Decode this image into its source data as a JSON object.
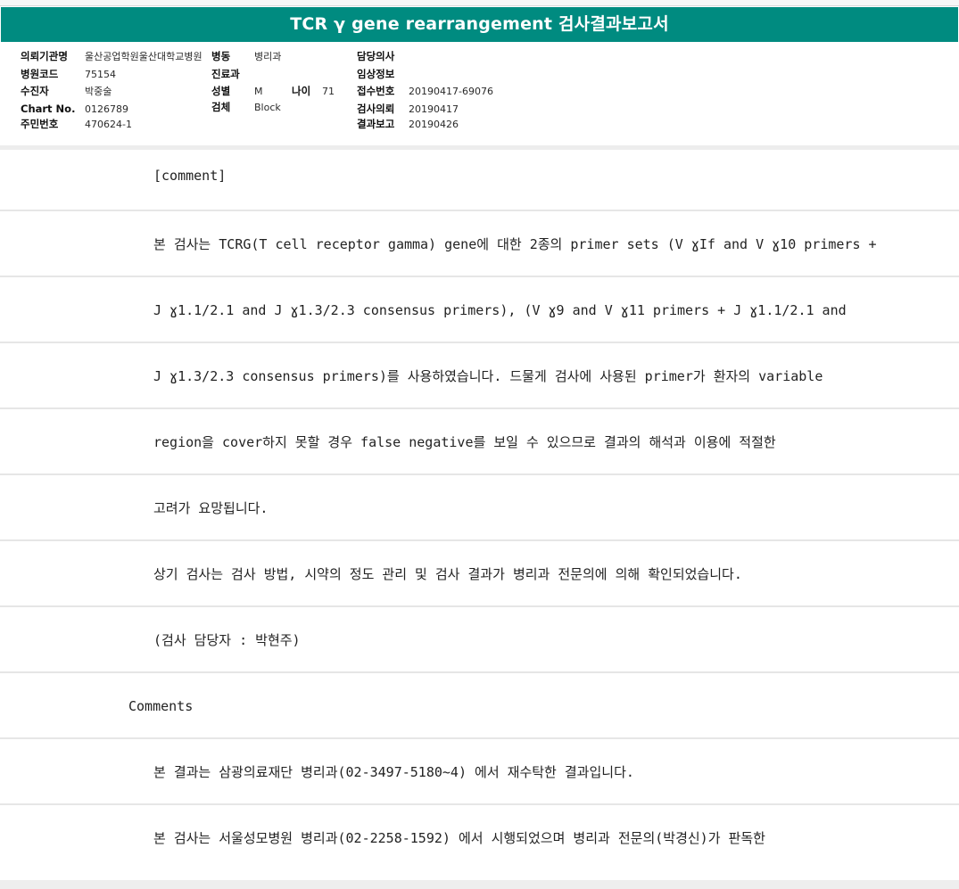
{
  "title": "TCR γ gene rearrangement 검사결과보고서",
  "header": {
    "institution_label": "의뢰기관명",
    "institution_value": "울산공업학원울산대학교병원",
    "ward_label": "병동",
    "ward_value": "병리과",
    "doctor_label": "담당의사",
    "doctor_value": "",
    "hospital_code_label": "병원코드",
    "hospital_code_value": "75154",
    "dept_label": "진료과",
    "dept_value": "",
    "clinical_info_label": "임상정보",
    "clinical_info_value": "",
    "patient_label": "수진자",
    "patient_value": "박중술",
    "sex_label": "성별",
    "sex_value": "M",
    "age_label": "나이",
    "age_value": "71",
    "receipt_label": "접수번호",
    "receipt_value": "20190417-69076",
    "chart_label": "Chart No.",
    "chart_value": "0126789",
    "specimen_label": "검체",
    "specimen_value": "Block",
    "request_label": "검사의뢰",
    "request_value": "20190417",
    "resident_label": "주민번호",
    "resident_value": "470624-1",
    "report_label": "결과보고",
    "report_value": "20190426"
  },
  "rows": [
    "[comment]",
    "본 검사는 TCRG(T cell receptor gamma) gene에 대한 2종의 primer sets (V ɣIf and V ɣ10 primers +",
    "J ɣ1.1/2.1 and J ɣ1.3/2.3 consensus primers), (V ɣ9 and V ɣ11 primers + J ɣ1.1/2.1 and",
    "J ɣ1.3/2.3 consensus primers)를 사용하였습니다. 드물게 검사에 사용된 primer가 환자의 variable",
    "region을 cover하지 못할 경우 false negative를 보일 수 있으므로 결과의 해석과 이용에 적절한",
    "고려가 요망됩니다.",
    "상기 검사는 검사 방법, 시약의 정도 관리 및 검사 결과가 병리과 전문의에 의해 확인되었습니다.",
    "(검사 담당자 : 박현주)",
    "Comments",
    "본 결과는 삼광의료재단 병리과(02-3497-5180~4) 에서 재수탁한 결과입니다.",
    "본 검사는 서울성모병원 병리과(02-2258-1592) 에서 시행되었으며 병리과 전문의(박경신)가 판독한"
  ]
}
